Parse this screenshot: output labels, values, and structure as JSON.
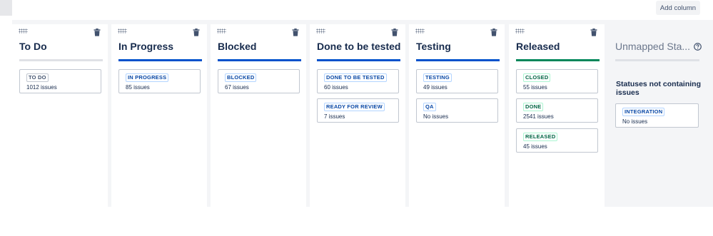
{
  "toolbar": {
    "add_column_label": "Add column"
  },
  "columns": [
    {
      "title": "To Do",
      "bar": "gray",
      "statuses": [
        {
          "label": "TO DO",
          "tone": "gray",
          "count": "1012 issues"
        }
      ]
    },
    {
      "title": "In Progress",
      "bar": "blue",
      "statuses": [
        {
          "label": "IN PROGRESS",
          "tone": "blue",
          "count": "85 issues"
        }
      ]
    },
    {
      "title": "Blocked",
      "bar": "blue",
      "statuses": [
        {
          "label": "BLOCKED",
          "tone": "blue",
          "count": "67 issues"
        }
      ]
    },
    {
      "title": "Done to be tested",
      "bar": "blue",
      "statuses": [
        {
          "label": "DONE TO BE TESTED",
          "tone": "blue",
          "count": "60 issues"
        },
        {
          "label": "READY FOR REVIEW",
          "tone": "blue",
          "count": "7 issues"
        }
      ]
    },
    {
      "title": "Testing",
      "bar": "blue",
      "statuses": [
        {
          "label": "TESTING",
          "tone": "blue",
          "count": "49 issues"
        },
        {
          "label": "QA",
          "tone": "blue",
          "count": "No issues"
        }
      ]
    },
    {
      "title": "Released",
      "bar": "green",
      "statuses": [
        {
          "label": "CLOSED",
          "tone": "green",
          "count": "55 issues"
        },
        {
          "label": "DONE",
          "tone": "green",
          "count": "2541 issues"
        },
        {
          "label": "RELEASED",
          "tone": "green",
          "count": "45 issues"
        }
      ]
    }
  ],
  "unmapped": {
    "title": "Unmapped Sta...",
    "note": "Statuses not containing issues",
    "statuses": [
      {
        "label": "INTEGRATION",
        "tone": "blue",
        "count": "No issues"
      }
    ]
  },
  "colors": {
    "blue": "#0052cc",
    "green": "#00875a",
    "gray": "#dfe1e6"
  },
  "icons": {
    "drag": "drag-handle-icon",
    "delete": "trash-icon",
    "help": "help-icon"
  }
}
